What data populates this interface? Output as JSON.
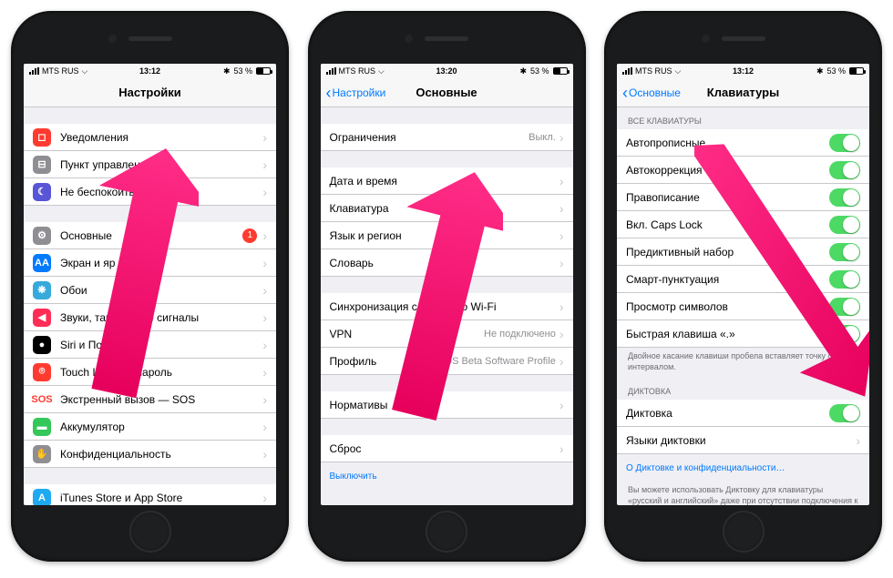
{
  "status": {
    "carrier": "MTS RUS",
    "bt": "✱",
    "battery_pct": "53 %"
  },
  "phone1": {
    "time": "13:12",
    "title": "Настройки",
    "group1": [
      {
        "icon": "#ff3b30",
        "glyph": "◻",
        "label": "Уведомления"
      },
      {
        "icon": "#8e8e93",
        "glyph": "⊟",
        "label": "Пункт управления"
      },
      {
        "icon": "#5856d6",
        "glyph": "☾",
        "label": "Не беспокоить"
      }
    ],
    "group2": [
      {
        "icon": "#8e8e93",
        "glyph": "⚙",
        "label": "Основные",
        "badge": "1"
      },
      {
        "icon": "#007aff",
        "glyph": "AA",
        "label": "Экран и яр"
      },
      {
        "icon": "#36aadc",
        "glyph": "❋",
        "label": "Обои"
      },
      {
        "icon": "#ff2d55",
        "glyph": "◀",
        "label": "Звуки, тактильные сигналы"
      },
      {
        "icon": "#000",
        "glyph": "●",
        "label": "Siri и Поиск"
      },
      {
        "icon": "#ff3b30",
        "glyph": "⌾",
        "label": "Touch ID и код-пароль"
      },
      {
        "icon": "#fff",
        "glyph": "SOS",
        "label": "Экстренный вызов — SOS",
        "txt": "#ff3b30"
      },
      {
        "icon": "#34c759",
        "glyph": "▬",
        "label": "Аккумулятор"
      },
      {
        "icon": "#8e8e93",
        "glyph": "✋",
        "label": "Конфиденциальность"
      }
    ],
    "group3": [
      {
        "icon": "#1eaaf1",
        "glyph": "A",
        "label": "iTunes Store и App Store"
      }
    ]
  },
  "phone2": {
    "time": "13:20",
    "back": "Настройки",
    "title": "Основные",
    "g1": [
      {
        "label": "Ограничения",
        "detail": "Выкл."
      }
    ],
    "g2": [
      {
        "label": "Дата и время"
      },
      {
        "label": "Клавиатура"
      },
      {
        "label": "Язык и регион"
      },
      {
        "label": "Словарь"
      }
    ],
    "g3": [
      {
        "label": "Синхронизация с iTunes по Wi-Fi"
      },
      {
        "label": "VPN",
        "detail": "Не подключено"
      },
      {
        "label": "Профиль",
        "detail": "iOS Beta Software Profile"
      }
    ],
    "g4": [
      {
        "label": "Нормативы"
      }
    ],
    "g5": [
      {
        "label": "Сброс"
      },
      {
        "label": "Выключить",
        "link": true
      }
    ]
  },
  "phone3": {
    "time": "13:12",
    "back": "Основные",
    "title": "Клавиатуры",
    "head1": "ВСЕ КЛАВИАТУРЫ",
    "toggles": [
      "Автопрописные",
      "Автокоррекция",
      "Правописание",
      "Вкл. Caps Lock",
      "Предиктивный набор",
      "Смарт-пунктуация",
      "Просмотр символов",
      "Быстрая клавиша «.»"
    ],
    "foot1": "Двойное касание клавиши пробела вставляет точку с интервалом.",
    "head2": "ДИКТОВКА",
    "dict": "Диктовка",
    "langs": "Языки диктовки",
    "about": "О Диктовке и конфиденциальности…",
    "foot2": "Вы можете использовать Диктовку для клавиатуры «русский и английский» даже при отсутствии подключения к Интернету."
  }
}
